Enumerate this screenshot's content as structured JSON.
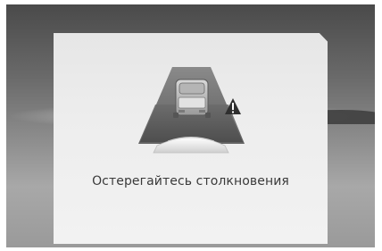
{
  "display": {
    "message": "Остерегайтесь столкновения",
    "icons": {
      "warning": "warning-triangle-icon",
      "vehicle_ahead": "vehicle-ahead-icon",
      "own_vehicle": "own-vehicle-hood-icon"
    }
  }
}
